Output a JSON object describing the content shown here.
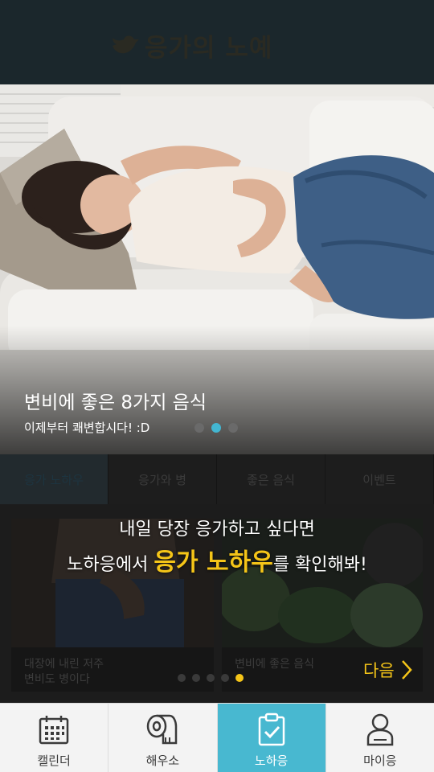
{
  "header": {
    "logo_text": "응가의 노예",
    "logo_icon": "bird-icon"
  },
  "hero": {
    "title": "변비에 좋은 8가지 음식",
    "subtitle": "이제부터 쾌변합시다! :D",
    "slide_count": 3,
    "active_slide": 2,
    "accent_color": "#43b6d1"
  },
  "tabs": [
    {
      "label": "응가 노하우",
      "active": true
    },
    {
      "label": "응가와 병",
      "active": false
    },
    {
      "label": "좋은 음식",
      "active": false
    },
    {
      "label": "이벤트",
      "active": false
    }
  ],
  "promo": {
    "line1": "내일 당장 응가하고 싶다면",
    "line2_pre": "노하응에서 ",
    "line2_highlight": "응가 노하우",
    "line2_post": "를 확인해봐!",
    "highlight_color": "#f5c518"
  },
  "cards": [
    {
      "caption_line1": "대장에 내린 저주",
      "caption_line2": "변비도 병이다"
    },
    {
      "caption_line1": "변비에 좋은 음식",
      "caption_line2": ""
    }
  ],
  "next_label": "다음",
  "panel_pager": {
    "count": 5,
    "active": 5
  },
  "bottom_nav": [
    {
      "label": "캘린더",
      "icon": "calendar-icon",
      "active": false
    },
    {
      "label": "해우소",
      "icon": "toilet-paper-icon",
      "active": false
    },
    {
      "label": "노하응",
      "icon": "clipboard-check-icon",
      "active": true
    },
    {
      "label": "마이응",
      "icon": "user-icon",
      "active": false
    }
  ]
}
